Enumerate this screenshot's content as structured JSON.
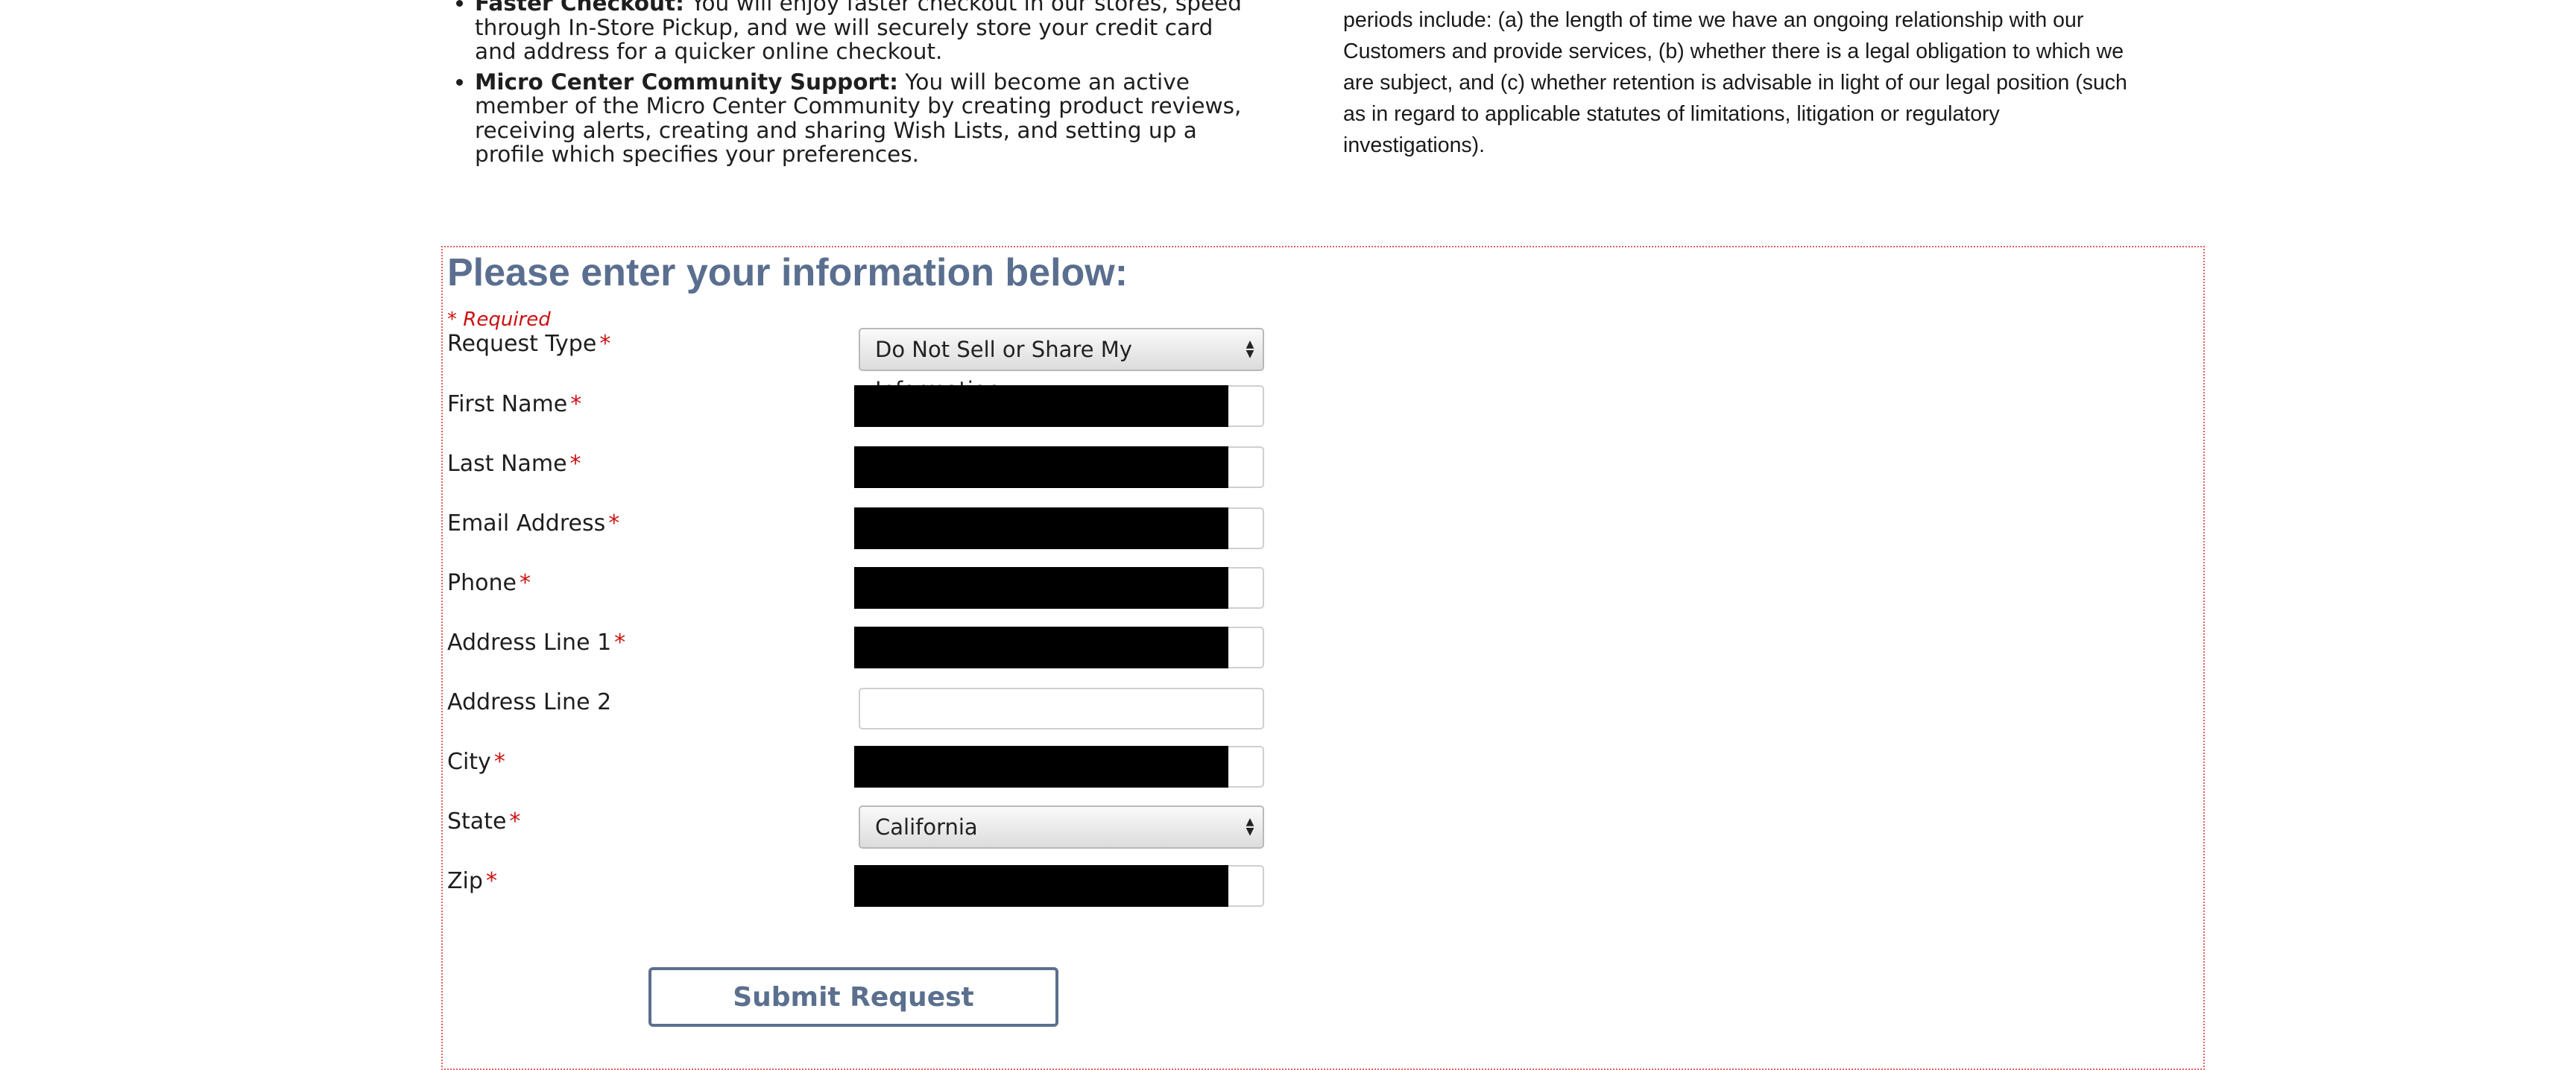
{
  "benefits": [
    {
      "title": "Faster Checkout:",
      "text": " You will enjoy faster checkout in our stores, speed through In-Store Pickup, and we will securely store your credit card and address for a quicker online checkout."
    },
    {
      "title": "Micro Center Community Support:",
      "text": " You will become an active member of the Micro Center Community by creating product reviews, receiving alerts, creating and sharing Wish Lists, and setting up a profile which specifies your preferences."
    }
  ],
  "retention_text": "periods include: (a) the length of time we have an ongoing relationship with our Customers and provide services, (b) whether there is a legal obligation to which we are subject, and (c) whether retention is advisable in light of our legal position (such as in regard to applicable statutes of limitations, litigation or regulatory investigations).",
  "form": {
    "title": "Please enter your information below:",
    "required_note": "* Required",
    "required_marker": "*",
    "fields": {
      "request_type": {
        "label": "Request Type",
        "value": "Do Not Sell or Share My Information"
      },
      "first_name": {
        "label": "First Name",
        "value": ""
      },
      "last_name": {
        "label": "Last Name",
        "value": ""
      },
      "email": {
        "label": "Email Address",
        "value": ""
      },
      "phone": {
        "label": "Phone",
        "value": ""
      },
      "address1": {
        "label": "Address Line 1",
        "value": ""
      },
      "address2": {
        "label": "Address Line 2",
        "value": ""
      },
      "city": {
        "label": "City",
        "value": ""
      },
      "state": {
        "label": "State",
        "value": "California"
      },
      "zip": {
        "label": "Zip",
        "value": ""
      }
    },
    "submit_label": "Submit Request"
  },
  "colors": {
    "heading": "#5a6f8f",
    "required": "#cc1111",
    "form_border": "#e06060",
    "redaction": "#000000"
  }
}
